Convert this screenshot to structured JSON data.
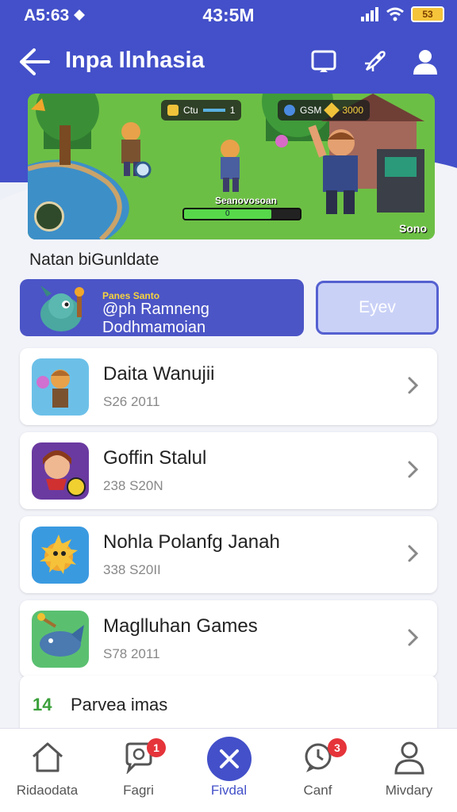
{
  "status_bar": {
    "carrier": "A5:63",
    "time": "43:5M",
    "battery": "53"
  },
  "header": {
    "title": "Inpa Ilnhasia"
  },
  "hero": {
    "hud_left": "Ctu",
    "hud_left_value": "1",
    "hud_right_label": "GSM",
    "hud_right_value": "3000",
    "caption": "Seanovosoan",
    "progress_label": "0",
    "progress": 0.75,
    "corner_label": "Sono"
  },
  "section": {
    "label": "Natan biGunldate"
  },
  "promo": {
    "small_text": "Panes Santo",
    "main_text": "@ph Ramneng Dodhmamoian",
    "button_label": "Eyev"
  },
  "games": [
    {
      "name": "Daita Wanujii",
      "meta": "S26 2011"
    },
    {
      "name": "Goffin Stalul",
      "meta": "238 S20N"
    },
    {
      "name": "Nohla Polanfg Janah",
      "meta": "338 S20II"
    },
    {
      "name": "Maglluhan Games",
      "meta": "S78 2011"
    }
  ],
  "more": {
    "count": "14",
    "label": "Parvea imas"
  },
  "tabs": [
    {
      "label": "Ridaodata"
    },
    {
      "label": "Fagri",
      "badge": "1"
    },
    {
      "label": "Fivdal"
    },
    {
      "label": "Canf",
      "badge": "3"
    },
    {
      "label": "Mivdary"
    }
  ],
  "colors": {
    "brand": "#4350c9",
    "badge": "#e5343a",
    "progress": "#57d84a"
  }
}
